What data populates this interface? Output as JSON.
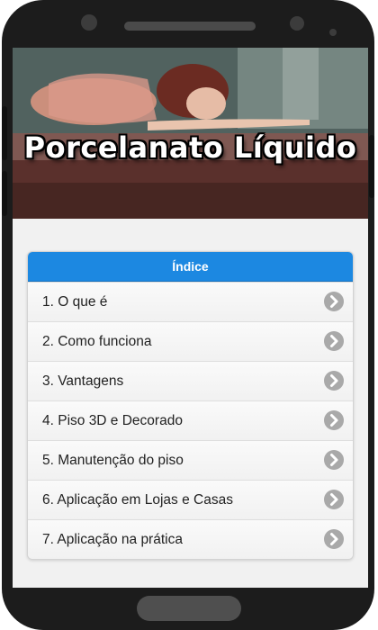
{
  "hero": {
    "title": "Porcelanato Líquido"
  },
  "index": {
    "header": "Índice",
    "items": [
      {
        "label": "1. O que é",
        "icon": "chevron-right-icon"
      },
      {
        "label": "2. Como funciona",
        "icon": "chevron-right-icon"
      },
      {
        "label": "3. Vantagens",
        "icon": "chevron-right-icon"
      },
      {
        "label": "4. Piso 3D e Decorado",
        "icon": "chevron-right-icon"
      },
      {
        "label": "5. Manutenção do piso",
        "icon": "chevron-right-icon"
      },
      {
        "label": "6. Aplicação em Lojas e Casas",
        "icon": "chevron-right-icon"
      },
      {
        "label": "7. Aplicação na prática",
        "icon": "chevron-right-icon"
      }
    ]
  },
  "colors": {
    "accent": "#1c88e1",
    "chevron": "#a9a9a9",
    "phone_body": "#1c1c1c"
  }
}
